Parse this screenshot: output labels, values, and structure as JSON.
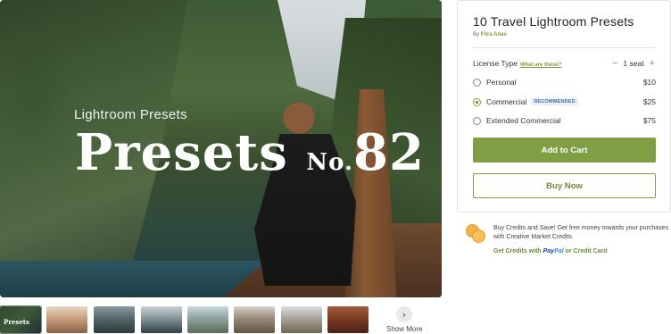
{
  "hero": {
    "subtitle": "Lightroom Presets",
    "title_main": "Presets ",
    "title_no": "No.",
    "title_num": "82"
  },
  "thumbnails": {
    "first_label": "Presets",
    "show_more": "Show More",
    "arrow": "›"
  },
  "product": {
    "title": "10 Travel Lightroom Presets",
    "by": "By ",
    "author": "Fitra Anas",
    "license_label": "License Type",
    "what_link": "What are these?",
    "seats_minus": "−",
    "seats_value": "1 seat",
    "seats_plus": "+",
    "options": [
      {
        "label": "Personal",
        "price": "$10",
        "selected": false
      },
      {
        "label": "Commercial",
        "badge": "RECOMMENDED",
        "price": "$25",
        "selected": true
      },
      {
        "label": "Extended Commercial",
        "price": "$75",
        "selected": false
      }
    ],
    "add_to_cart": "Add to Cart",
    "buy_now": "Buy Now"
  },
  "credits": {
    "text": "Buy Credits and Save! Get free money towards your purchases with Creative Market Credits.",
    "link_prefix": "Get Credits with ",
    "paypal_a": "Pay",
    "paypal_b": "Pal",
    "link_suffix": " or Credit Card"
  },
  "colors": {
    "accent": "#809e43",
    "author_link": "#7c9a3f",
    "badge_text": "#4a6fa0"
  }
}
